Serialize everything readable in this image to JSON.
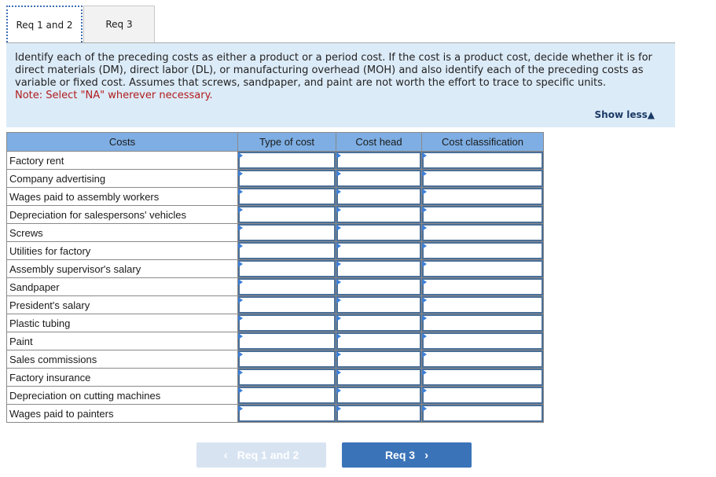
{
  "tabs": [
    {
      "label": "Req 1 and 2",
      "active": true
    },
    {
      "label": "Req 3",
      "active": false
    }
  ],
  "instructions": {
    "text": "Identify each of the preceding costs as either a product or a period cost. If the cost is a product cost, decide whether it is for direct materials (DM), direct labor (DL), or manufacturing overhead (MOH) and also identify each of the preceding costs as variable or fixed cost. Assumes that screws, sandpaper, and paint are not worth the effort to trace to specific units.",
    "note": "Note: Select \"NA\" wherever necessary.",
    "toggle_label": "Show less",
    "toggle_icon": "triangle-up-icon",
    "toggle_glyph": "▲"
  },
  "table": {
    "headers": [
      "Costs",
      "Type of cost",
      "Cost head",
      "Cost classification"
    ],
    "rows": [
      {
        "cost": "Factory rent",
        "type": "",
        "head": "",
        "classification": ""
      },
      {
        "cost": "Company advertising",
        "type": "",
        "head": "",
        "classification": ""
      },
      {
        "cost": "Wages paid to assembly workers",
        "type": "",
        "head": "",
        "classification": ""
      },
      {
        "cost": "Depreciation for salespersons' vehicles",
        "type": "",
        "head": "",
        "classification": ""
      },
      {
        "cost": "Screws",
        "type": "",
        "head": "",
        "classification": ""
      },
      {
        "cost": "Utilities for factory",
        "type": "",
        "head": "",
        "classification": ""
      },
      {
        "cost": "Assembly supervisor's salary",
        "type": "",
        "head": "",
        "classification": ""
      },
      {
        "cost": "Sandpaper",
        "type": "",
        "head": "",
        "classification": ""
      },
      {
        "cost": "President's salary",
        "type": "",
        "head": "",
        "classification": ""
      },
      {
        "cost": "Plastic tubing",
        "type": "",
        "head": "",
        "classification": ""
      },
      {
        "cost": "Paint",
        "type": "",
        "head": "",
        "classification": ""
      },
      {
        "cost": "Sales commissions",
        "type": "",
        "head": "",
        "classification": ""
      },
      {
        "cost": "Factory insurance",
        "type": "",
        "head": "",
        "classification": ""
      },
      {
        "cost": "Depreciation on cutting machines",
        "type": "",
        "head": "",
        "classification": ""
      },
      {
        "cost": "Wages paid to painters",
        "type": "",
        "head": "",
        "classification": ""
      }
    ]
  },
  "navigation": {
    "prev": {
      "label": "Req 1 and 2",
      "glyph": "‹",
      "enabled": false
    },
    "next": {
      "label": "Req 3",
      "glyph": "›",
      "enabled": true
    }
  },
  "colors": {
    "header_bg": "#7eaee3",
    "instructions_bg": "#dcebf8",
    "note": "#b01c1c",
    "next_button": "#3a73b8",
    "prev_button_disabled": "#d7e3f1"
  }
}
